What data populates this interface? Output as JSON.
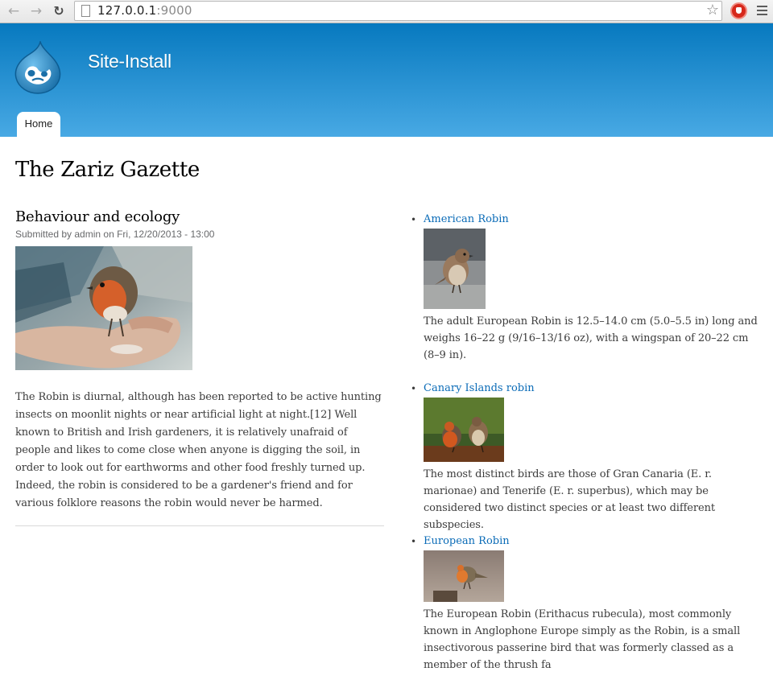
{
  "browser": {
    "url_host": "127.0.0.1",
    "url_port": ":9000",
    "back_icon": "back-arrow-icon",
    "forward_icon": "forward-arrow-icon",
    "reload_icon": "reload-icon",
    "bookmark_icon": "star-icon",
    "extension_icon": "adblock-icon",
    "menu_icon": "hamburger-menu-icon"
  },
  "site": {
    "name": "Site-Install",
    "logo_icon": "drupal-drop-logo",
    "nav": {
      "home_label": "Home"
    }
  },
  "page": {
    "title": "The Zariz Gazette"
  },
  "article": {
    "title": "Behaviour and ecology",
    "submitted": "Submitted by admin on Fri, 12/20/2013 - 13:00",
    "body": "The Robin is diurnal, although has been reported to be active hunting insects on moonlit nights or near artificial light at night.[12] Well known to British and Irish gardeners, it is relatively unafraid of people and likes to come close when anyone is digging the soil, in order to look out for earthworms and other food freshly turned up. Indeed, the robin is considered to be a gardener's friend and for various folklore reasons the robin would never be harmed."
  },
  "related": [
    {
      "title": "American Robin",
      "text": "The adult European Robin is 12.5–14.0 cm (5.0–5.5 in) long and weighs 16–22 g (9/16–13/16 oz), with a wingspan of 20–22 cm (8–9 in)."
    },
    {
      "title": "Canary Islands robin",
      "text": "The most distinct birds are those of Gran Canaria (E. r. marionae) and Tenerife (E. r. superbus), which may be considered two distinct species or at least two different subspecies."
    },
    {
      "title": "European Robin",
      "text": "The European Robin (Erithacus rubecula), most commonly known in Anglophone Europe simply as the Robin, is a small insectivorous passerine bird that was formerly classed as a member of the thrush fa"
    }
  ],
  "colors": {
    "header_top": "#0779bf",
    "header_bottom": "#48a9e4",
    "link": "#0a6bb7"
  }
}
